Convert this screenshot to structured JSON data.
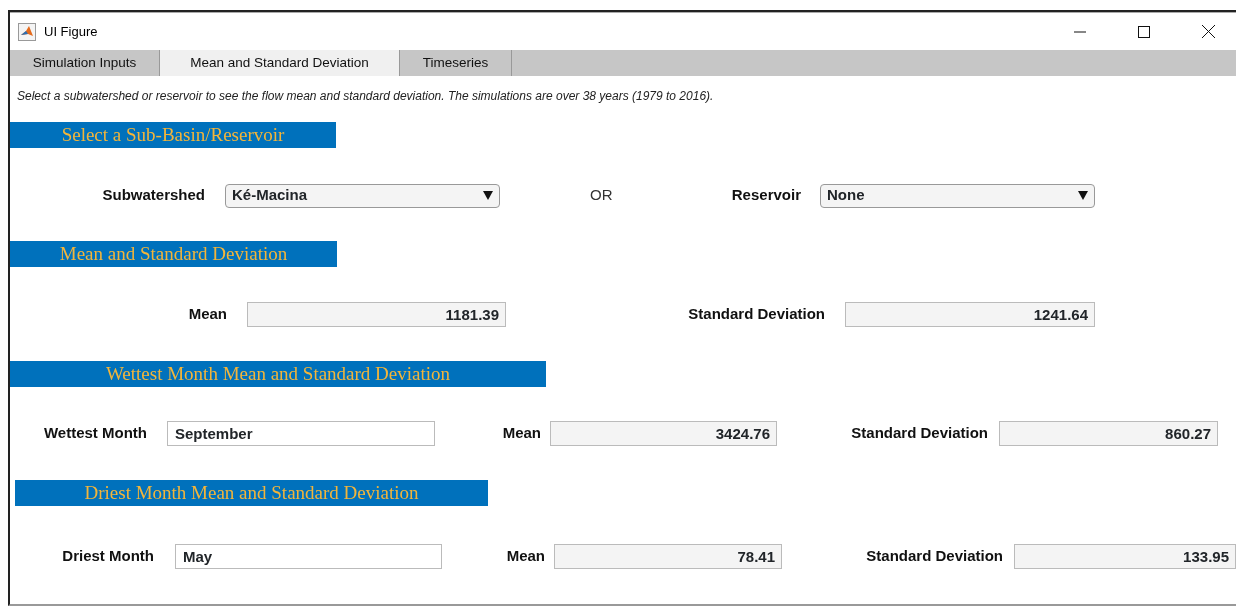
{
  "window": {
    "title": "UI Figure"
  },
  "tabs": [
    {
      "label": "Simulation Inputs",
      "selected": false
    },
    {
      "label": "Mean and Standard Deviation",
      "selected": true
    },
    {
      "label": "Timeseries",
      "selected": false
    }
  ],
  "description": "Select a subwatershed or reservoir to see the flow mean and standard deviation. The simulations are over 38 years (1979 to 2016).",
  "sections": [
    {
      "heading": "Select a Sub-Basin/Reservoir",
      "items": [
        {
          "kind": "label",
          "text": "Subwatershed"
        },
        {
          "kind": "dropdown",
          "value": "Ké-Macina"
        },
        {
          "kind": "text",
          "text": "OR"
        },
        {
          "kind": "label",
          "text": "Reservoir"
        },
        {
          "kind": "dropdown",
          "value": "None"
        }
      ]
    },
    {
      "heading": "Mean and Standard Deviation",
      "items": [
        {
          "kind": "label",
          "text": "Mean"
        },
        {
          "kind": "readout",
          "value": "1181.39"
        },
        {
          "kind": "label",
          "text": "Standard Deviation"
        },
        {
          "kind": "readout",
          "value": "1241.64"
        }
      ]
    },
    {
      "heading": "Wettest Month Mean and Standard Deviation",
      "items": [
        {
          "kind": "label",
          "text": "Wettest Month"
        },
        {
          "kind": "entry",
          "value": "September"
        },
        {
          "kind": "label",
          "text": "Mean"
        },
        {
          "kind": "readout",
          "value": "3424.76"
        },
        {
          "kind": "label",
          "text": "Standard Deviation"
        },
        {
          "kind": "readout",
          "value": "860.27"
        }
      ]
    },
    {
      "heading": "Driest Month Mean and Standard Deviation",
      "items": [
        {
          "kind": "label",
          "text": "Driest Month"
        },
        {
          "kind": "entry",
          "value": "May"
        },
        {
          "kind": "label",
          "text": "Mean"
        },
        {
          "kind": "readout",
          "value": "78.41"
        },
        {
          "kind": "label",
          "text": "Standard Deviation"
        },
        {
          "kind": "readout",
          "value": "133.95"
        }
      ]
    }
  ]
}
